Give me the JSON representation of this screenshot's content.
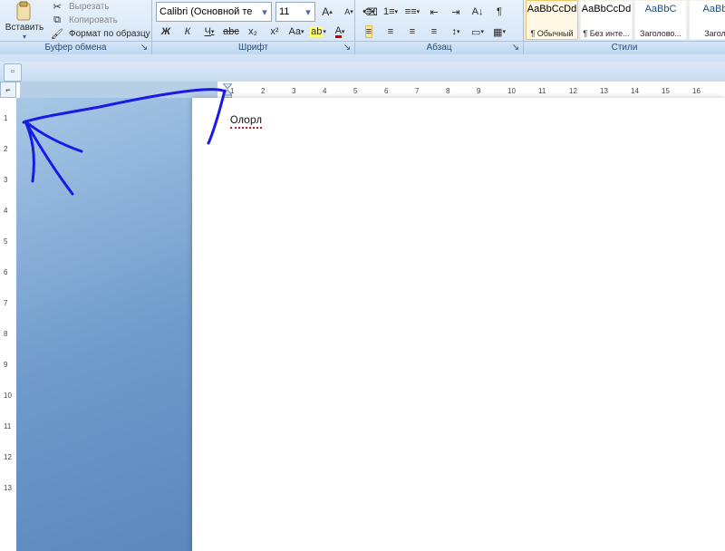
{
  "clipboard": {
    "paste": "Вставить",
    "cut": "Вырезать",
    "copy": "Копировать",
    "format_painter": "Формат по образцу",
    "group_label": "Буфер обмена"
  },
  "font": {
    "family": "Calibri (Основной те",
    "size": "11",
    "grow": "A",
    "shrink": "A",
    "clear": "⌫",
    "bold": "Ж",
    "italic": "К",
    "underline": "Ч",
    "strike": "abc",
    "sub": "x₂",
    "sup": "x²",
    "case": "Aa",
    "highlight": "ab",
    "font_color": "A",
    "group_label": "Шрифт"
  },
  "paragraph": {
    "bullets": "•≡",
    "numbers": "1≡",
    "multilevel": "≡≡",
    "dec_indent": "⇤",
    "inc_indent": "⇥",
    "sort": "A↓",
    "show": "¶",
    "al": "≡",
    "ac": "≡",
    "ar": "≡",
    "aj": "≡",
    "linesp": "↕",
    "shade": "▭",
    "border": "▦",
    "group_label": "Абзац"
  },
  "styles": {
    "items": [
      {
        "preview": "AaBbCcDd",
        "name": "¶ Обычный",
        "sel": true,
        "color": "#000"
      },
      {
        "preview": "AaBbCcDd",
        "name": "¶ Без инте...",
        "sel": false,
        "color": "#000"
      },
      {
        "preview": "AaBbC",
        "name": "Заголово...",
        "sel": false,
        "color": "#1f4e79"
      },
      {
        "preview": "AaBb",
        "name": "Загол",
        "sel": false,
        "color": "#1f4e79"
      }
    ],
    "group_label": "Стили"
  },
  "document": {
    "text": "Олорл"
  },
  "ruler": {
    "h_numbers": [
      "1",
      "2",
      "3",
      "4",
      "5",
      "6",
      "7",
      "8",
      "9",
      "10",
      "11",
      "12",
      "13",
      "14",
      "15",
      "16"
    ],
    "v_numbers": [
      "1",
      "2",
      "3",
      "4",
      "5",
      "6",
      "7",
      "8",
      "9",
      "10",
      "11",
      "12",
      "13"
    ]
  }
}
